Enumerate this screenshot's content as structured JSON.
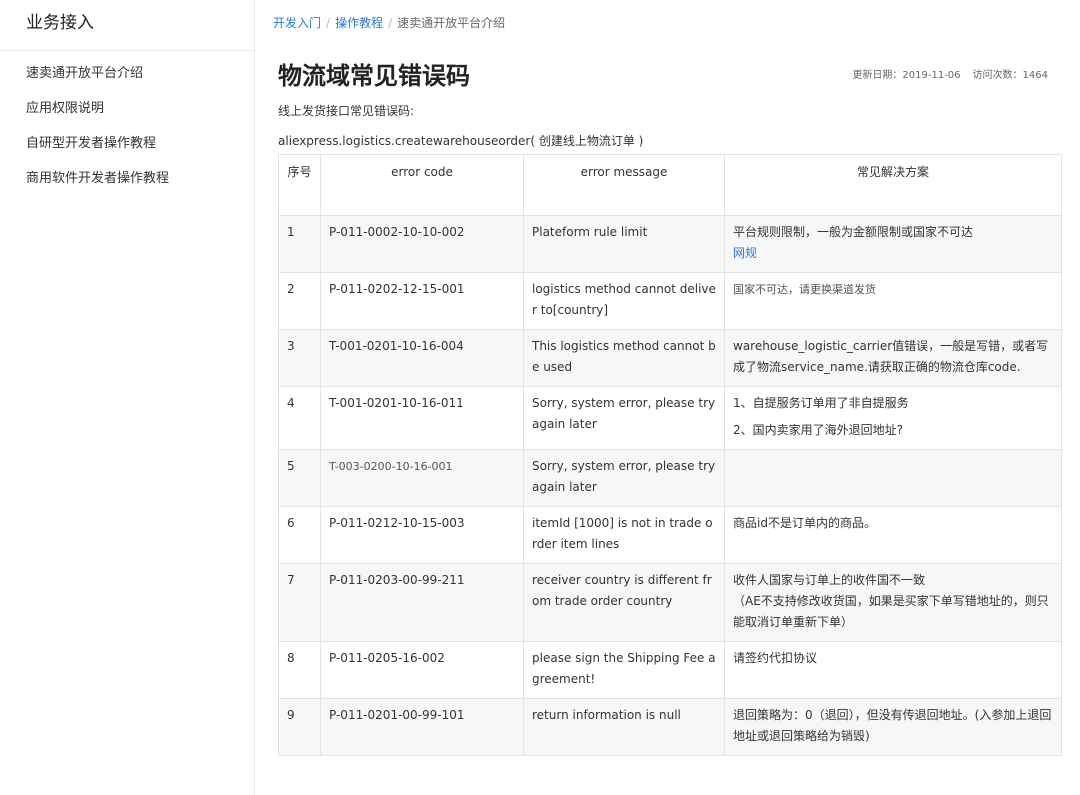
{
  "sidebar": {
    "title": "业务接入",
    "items": [
      {
        "label": "速卖通开放平台介绍"
      },
      {
        "label": "应用权限说明"
      },
      {
        "label": "自研型开发者操作教程"
      },
      {
        "label": "商用软件开发者操作教程"
      }
    ]
  },
  "breadcrumb": {
    "items": [
      "开发入门",
      "操作教程",
      "速卖通开放平台介绍"
    ],
    "separator": "/"
  },
  "page": {
    "title": "物流域常见错误码",
    "updated": "更新日期：2019-11-06",
    "visits": "访问次数：1464",
    "intro": "线上发货接口常见错误码:",
    "method": "aliexpress.logistics.createwarehouseorder( 创建线上物流订单 )"
  },
  "table": {
    "headers": {
      "seq": "序号",
      "code": "error code",
      "message": "error message",
      "solution": "常见解决方案"
    },
    "rows": [
      {
        "seq": "1",
        "code": "P-011-0002-10-10-002",
        "message": "Plateform rule limit",
        "solution": "平台规则限制，一般为金额限制或国家不可达",
        "link": "网规"
      },
      {
        "seq": "2",
        "code": "P-011-0202-12-15-001",
        "message": "logistics method cannot deliver to[country]",
        "solution": "国家不可达，请更换渠道发货"
      },
      {
        "seq": "3",
        "code": "T-001-0201-10-16-004",
        "message": "This logistics method cannot be used",
        "solution": "warehouse_logistic_carrier值错误，一般是写错，或者写成了物流service_name.请获取正确的物流仓库code."
      },
      {
        "seq": "4",
        "code": "T-001-0201-10-16-011",
        "message": "Sorry, system error, please try again later",
        "solution": "1、自提服务订单用了非自提服务",
        "solution2": "2、国内卖家用了海外退回地址?"
      },
      {
        "seq": "5",
        "code": "T-003-0200-10-16-001",
        "message": "Sorry, system error, please try again later",
        "solution": ""
      },
      {
        "seq": "6",
        "code": "P-011-0212-10-15-003",
        "message": "itemId [1000] is not in trade order item lines",
        "solution": "商品id不是订单内的商品。"
      },
      {
        "seq": "7",
        "code": "P-011-0203-00-99-211",
        "message": "receiver country is different from trade order country",
        "solution": "收件人国家与订单上的收件国不一致",
        "solution2": "（AE不支持修改收货国，如果是买家下单写错地址的，则只能取消订单重新下单）"
      },
      {
        "seq": "8",
        "code": "P-011-0205-16-002",
        "message": "please sign the Shipping Fee agreement!",
        "solution": "请签约代扣协议"
      },
      {
        "seq": "9",
        "code": "P-011-0201-00-99-101",
        "message": "return information is null",
        "solution": "退回策略为：0（退回），但没有传退回地址。(入参加上退回地址或退回策略给为销毁)"
      }
    ]
  }
}
